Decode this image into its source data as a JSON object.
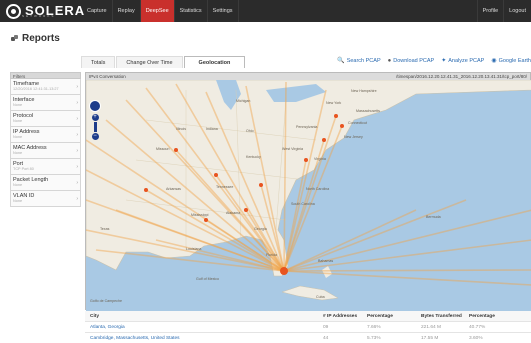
{
  "app": {
    "logo_text": "SOLERA",
    "logo_sub": "NETWORKS"
  },
  "nav": {
    "items": [
      "Capture",
      "Replay",
      "DeepSee",
      "Statistics",
      "Settings"
    ],
    "active": "DeepSee",
    "right": [
      "Profile",
      "Logout"
    ]
  },
  "page": {
    "title": "Reports"
  },
  "tabs": {
    "items": [
      "Totals",
      "Change Over Time",
      "Geolocation"
    ],
    "active": "Geolocation"
  },
  "actions": [
    {
      "icon": "search-icon",
      "label": "Search PCAP"
    },
    {
      "icon": "download-icon",
      "label": "Download PCAP"
    },
    {
      "icon": "analyze-icon",
      "label": "Analyze PCAP"
    },
    {
      "icon": "globe-icon",
      "label": "Google Earth"
    }
  ],
  "filters": {
    "heading": "Filters",
    "items": [
      {
        "label": "Timeframe",
        "value": "12/20/2016 12:41:31-13:27"
      },
      {
        "label": "Interface",
        "value": "None"
      },
      {
        "label": "Protocol",
        "value": "None"
      },
      {
        "label": "IP Address",
        "value": "None"
      },
      {
        "label": "MAC Address",
        "value": "None"
      },
      {
        "label": "Port",
        "value": "TCP Port 80"
      },
      {
        "label": "Packet Length",
        "value": "None"
      },
      {
        "label": "VLAN ID",
        "value": "None"
      }
    ]
  },
  "panel": {
    "title": "IPv4 Conversation",
    "file": "/timespan/2016.12.20.12.41.31_2016.12.20.13.41.31/tcp_port/80/"
  },
  "map_labels": [
    "Michigan",
    "New York",
    "New Hampshire",
    "Massachusetts",
    "Connecticut",
    "Illinois",
    "Indiana",
    "Ohio",
    "Pennsylvania",
    "New Jersey",
    "Missouri",
    "West Virginia",
    "Virginia",
    "Kentucky",
    "Tennessee",
    "North Carolina",
    "Arkansas",
    "South Carolina",
    "Alabama",
    "Georgia",
    "Mississippi",
    "Louisiana",
    "Texas",
    "Florida",
    "Bahamas",
    "Cuba",
    "Bermuda",
    "Gulf of Mexico",
    "Golfo de Campeche"
  ],
  "table": {
    "headers": [
      "City",
      "# IP Addresses",
      "Percentage",
      "Bytes Transferred",
      "Percentage"
    ],
    "rows": [
      {
        "city": "Atlanta, Georgia",
        "ips": "09",
        "pct": "7.66%",
        "bytes": "221.64 M",
        "pct2": "40.77%"
      },
      {
        "city": "Cambridge, Massachusetts, United States",
        "ips": "44",
        "pct": "5.73%",
        "bytes": "17.55 M",
        "pct2": "3.60%"
      }
    ]
  },
  "colors": {
    "nav_bg": "#2b2b2b",
    "nav_active": "#c9302c",
    "link": "#2a6ab0",
    "connection_line": "#f0a34a",
    "marker": "#e8541f"
  }
}
